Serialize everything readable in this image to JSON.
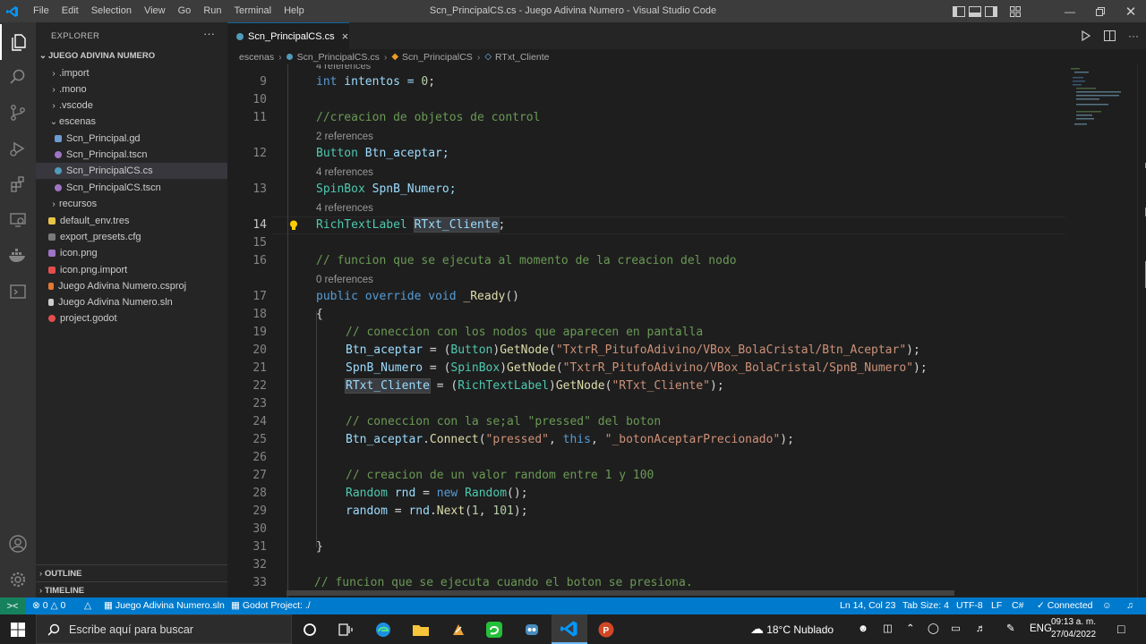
{
  "window": {
    "title": "Scn_PrincipalCS.cs - Juego Adivina Numero - Visual Studio Code"
  },
  "menu": [
    "File",
    "Edit",
    "Selection",
    "View",
    "Go",
    "Run",
    "Terminal",
    "Help"
  ],
  "explorer": {
    "header": "EXPLORER",
    "more": "···",
    "root": "JUEGO ADIVINA NUMERO",
    "items": [
      {
        "label": ".import",
        "kind": "folder"
      },
      {
        "label": ".mono",
        "kind": "folder"
      },
      {
        "label": ".vscode",
        "kind": "folder"
      },
      {
        "label": "escenas",
        "kind": "folder-open"
      },
      {
        "label": "Scn_Principal.gd",
        "kind": "gd"
      },
      {
        "label": "Scn_Principal.tscn",
        "kind": "tscn"
      },
      {
        "label": "Scn_PrincipalCS.cs",
        "kind": "cs"
      },
      {
        "label": "Scn_PrincipalCS.tscn",
        "kind": "tscn"
      },
      {
        "label": "recursos",
        "kind": "folder"
      },
      {
        "label": "default_env.tres",
        "kind": "tres"
      },
      {
        "label": "export_presets.cfg",
        "kind": "cfg"
      },
      {
        "label": "icon.png",
        "kind": "png"
      },
      {
        "label": "icon.png.import",
        "kind": "import"
      },
      {
        "label": "Juego Adivina Numero.csproj",
        "kind": "csproj"
      },
      {
        "label": "Juego Adivina Numero.sln",
        "kind": "sln"
      },
      {
        "label": "project.godot",
        "kind": "godot"
      }
    ],
    "outline": "OUTLINE",
    "timeline": "TIMELINE"
  },
  "tab": {
    "label": "Scn_PrincipalCS.cs",
    "close": "×"
  },
  "breadcrumb": [
    "escenas",
    "Scn_PrincipalCS.cs",
    "Scn_PrincipalCS",
    "RTxt_Cliente"
  ],
  "editor": {
    "top_lens": "4 references",
    "lines": {
      "9": "9",
      "10": "10",
      "11": "11",
      "12": "12",
      "13": "13",
      "14": "14",
      "15": "15",
      "16": "16",
      "17": "17",
      "18": "18",
      "19": "19",
      "20": "20",
      "21": "21",
      "22": "22",
      "23": "23",
      "24": "24",
      "25": "25",
      "26": "26",
      "27": "27",
      "28": "28",
      "29": "29",
      "30": "30",
      "31": "31",
      "32": "32",
      "33": "33"
    },
    "lens": {
      "l12": "2 references",
      "l13": "4 references",
      "l14": "4 references",
      "l17": "0 references"
    },
    "code": {
      "l9": [
        "int",
        " intentos = ",
        "0",
        ";"
      ],
      "l11": "//creacion de objetos de control",
      "l12": [
        "Button",
        " Btn_aceptar;"
      ],
      "l13": [
        "SpinBox",
        " SpnB_Numero;"
      ],
      "l14": [
        "RichTextLabel",
        " ",
        "RTxt_Cliente",
        ";"
      ],
      "l16": "// funcion que se ejecuta al momento de la creacion del nodo",
      "l17": [
        "public",
        " ",
        "override",
        " ",
        "void",
        " ",
        "_Ready",
        "()"
      ],
      "l18": "{",
      "l19": "// coneccion con los nodos que aparecen en pantalla",
      "l20": [
        "Btn_aceptar",
        " = (",
        "Button",
        ")",
        "GetNode",
        "(",
        "\"TxtrR_PitufoAdivino/VBox_BolaCristal/Btn_Aceptar\"",
        ");"
      ],
      "l21": [
        "SpnB_Numero",
        " = (",
        "SpinBox",
        ")",
        "GetNode",
        "(",
        "\"TxtrR_PitufoAdivino/VBox_BolaCristal/SpnB_Numero\"",
        ");"
      ],
      "l22": [
        "RTxt_Cliente",
        " = (",
        "RichTextLabel",
        ")",
        "GetNode",
        "(",
        "\"RTxt_Cliente\"",
        ");"
      ],
      "l24": "// coneccion con la se;al \"pressed\" del boton",
      "l25": [
        "Btn_aceptar",
        ".",
        "Connect",
        "(",
        "\"pressed\"",
        ", ",
        "this",
        ", ",
        "\"_botonAceptarPrecionado\"",
        ");"
      ],
      "l27": "// creacion de un valor random entre 1 y 100",
      "l28": [
        "Random",
        " ",
        "rnd",
        " = ",
        "new",
        " ",
        "Random",
        "();"
      ],
      "l29": [
        "random",
        " = ",
        "rnd",
        ".",
        "Next",
        "(",
        "1",
        ", ",
        "101",
        ");"
      ],
      "l31": "}",
      "l33": "// funcion que se ejecuta cuando el boton se presiona."
    }
  },
  "status": {
    "remote": "><",
    "errors": "0",
    "warnings": "0",
    "solution": "Juego Adivina Numero.sln",
    "godot": "Godot Project: ./",
    "position": "Ln 14, Col 23",
    "tabsize": "Tab Size: 4",
    "encoding": "UTF-8",
    "eol": "LF",
    "language": "C#",
    "connected": "Connected"
  },
  "taskbar": {
    "search_placeholder": "Escribe aquí para buscar",
    "weather": "18°C  Nublado",
    "lang": "ENG",
    "time": "09:13 a. m.",
    "date": "27/04/2022"
  },
  "colors": {
    "accent": "#007acc",
    "remote": "#16825d",
    "titlebar": "#3c3c3c",
    "editor_bg": "#1e1e1e",
    "sidebar_bg": "#252526"
  }
}
